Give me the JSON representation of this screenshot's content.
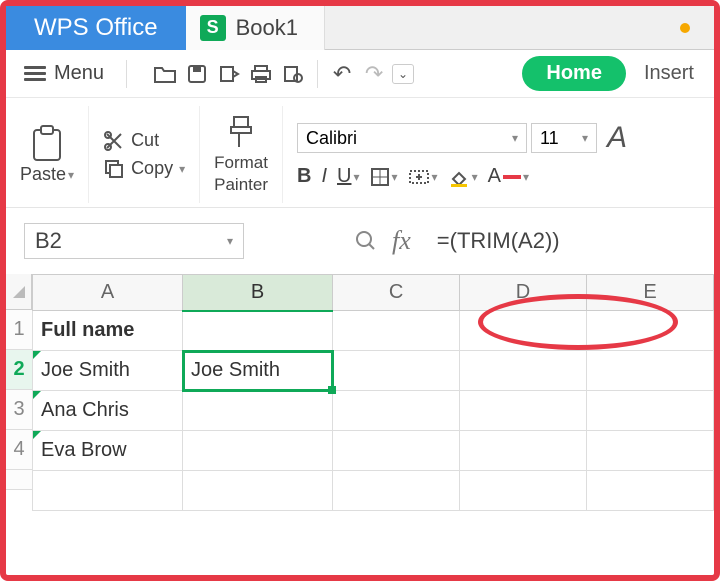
{
  "app": {
    "title": "WPS Office"
  },
  "tab": {
    "icon_letter": "S",
    "name": "Book1"
  },
  "menu": {
    "label": "Menu"
  },
  "qat": {
    "icons": [
      "open-icon",
      "save-icon",
      "export-icon",
      "print-icon",
      "preview-icon"
    ],
    "undo": "↶",
    "redo": "↷",
    "more": "⌄"
  },
  "ribbon_tabs": {
    "home": "Home",
    "insert": "Insert"
  },
  "clipboard": {
    "paste": "Paste",
    "cut": "Cut",
    "copy": "Copy",
    "format_painter_l1": "Format",
    "format_painter_l2": "Painter"
  },
  "font": {
    "name": "Calibri",
    "size": "11",
    "bold": "B",
    "italic": "I",
    "underline": "U",
    "a_large": "A"
  },
  "formula_bar": {
    "name_box": "B2",
    "fx": "fx",
    "formula": "=(TRIM(A2))"
  },
  "grid": {
    "columns": [
      "A",
      "B",
      "C",
      "D",
      "E"
    ],
    "active_col": "B",
    "rows": [
      "1",
      "2",
      "3",
      "4"
    ],
    "active_row": "2",
    "cells": {
      "A1": "Full name",
      "A2": " Joe Smith",
      "B2": "Joe Smith",
      "A3": " Ana Chris",
      "A4": " Eva Brow"
    }
  },
  "chart_data": null
}
